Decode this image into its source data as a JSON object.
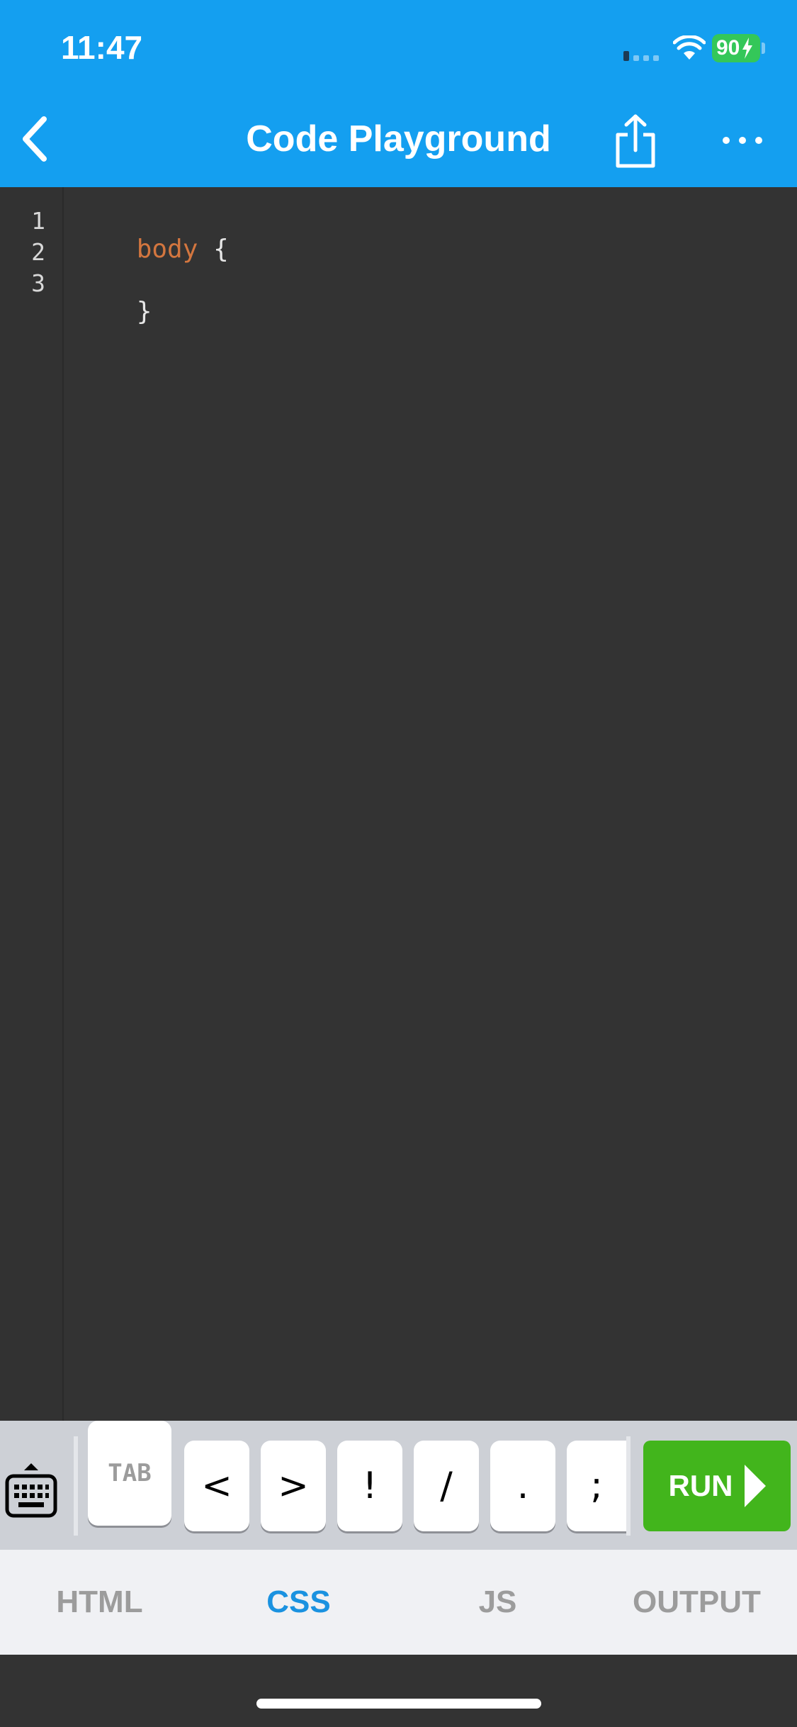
{
  "status_bar": {
    "time": "11:47",
    "battery": "90"
  },
  "nav": {
    "title": "Code Playground",
    "icons": [
      "chevron-left-icon",
      "share-icon",
      "more-horizontal-icon"
    ]
  },
  "editor": {
    "line_numbers": [
      "1",
      "2",
      "3"
    ],
    "lines": [
      {
        "selector": "body",
        "brace": " {"
      },
      {
        "selector": "",
        "brace": ""
      },
      {
        "selector": "",
        "brace": "}"
      }
    ]
  },
  "accessory": {
    "keyboard_icon": "keyboard-hide-icon",
    "keys": [
      "TAB",
      "<",
      ">",
      "!",
      "/",
      ".",
      ";"
    ],
    "run_label": "RUN"
  },
  "tabs": [
    "HTML",
    "CSS",
    "JS",
    "OUTPUT"
  ],
  "active_tab": "CSS",
  "colors": {
    "header": "#149ff0",
    "editor_bg": "#333333",
    "selector": "#d3763f",
    "run": "#42b51c",
    "active_tab": "#1a92e0",
    "battery": "#34c759"
  }
}
